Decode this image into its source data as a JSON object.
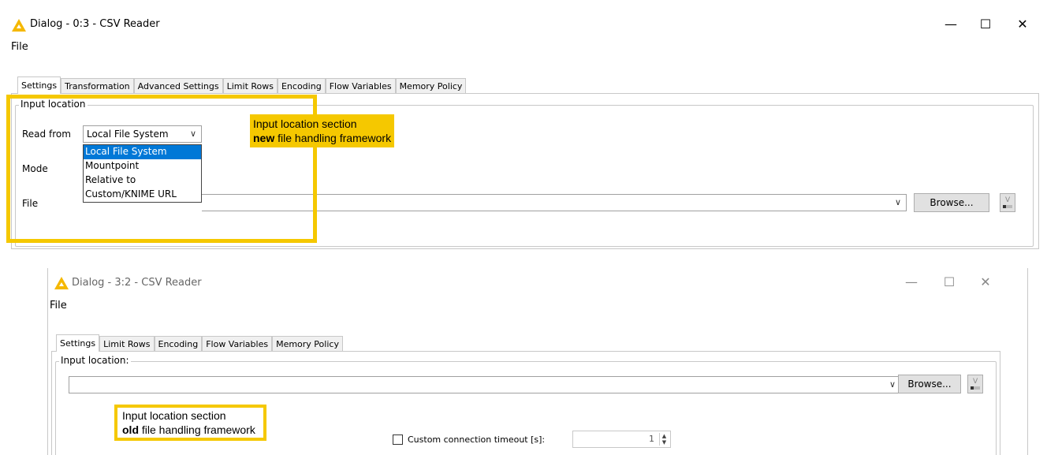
{
  "top_dialog": {
    "title": "Dialog - 0:3 - CSV Reader",
    "menu": "File",
    "tabs": [
      "Settings",
      "Transformation",
      "Advanced Settings",
      "Limit Rows",
      "Encoding",
      "Flow Variables",
      "Memory Policy"
    ],
    "active_tab": "Settings",
    "group_title": "Input location",
    "read_from_label": "Read from",
    "read_from_value": "Local File System",
    "read_from_options": [
      "Local File System",
      "Mountpoint",
      "Relative to",
      "Custom/KNIME URL"
    ],
    "mode_label": "Mode",
    "file_label": "File",
    "browse_label": "Browse...",
    "annotation_line1": "Input location section",
    "annotation_bold": "new",
    "annotation_rest": " file handling framework"
  },
  "bottom_dialog": {
    "title": "Dialog - 3:2 - CSV Reader",
    "menu": "File",
    "tabs": [
      "Settings",
      "Limit Rows",
      "Encoding",
      "Flow Variables",
      "Memory Policy"
    ],
    "active_tab": "Settings",
    "group_title": "Input location:",
    "browse_label": "Browse...",
    "timeout_label": "Custom connection timeout [s]:",
    "timeout_value": "1",
    "annotation_line1": "Input location section",
    "annotation_bold": "old",
    "annotation_rest": " file handling framework"
  },
  "colors": {
    "annotation": "#f5c800",
    "selection": "#0078d7"
  }
}
